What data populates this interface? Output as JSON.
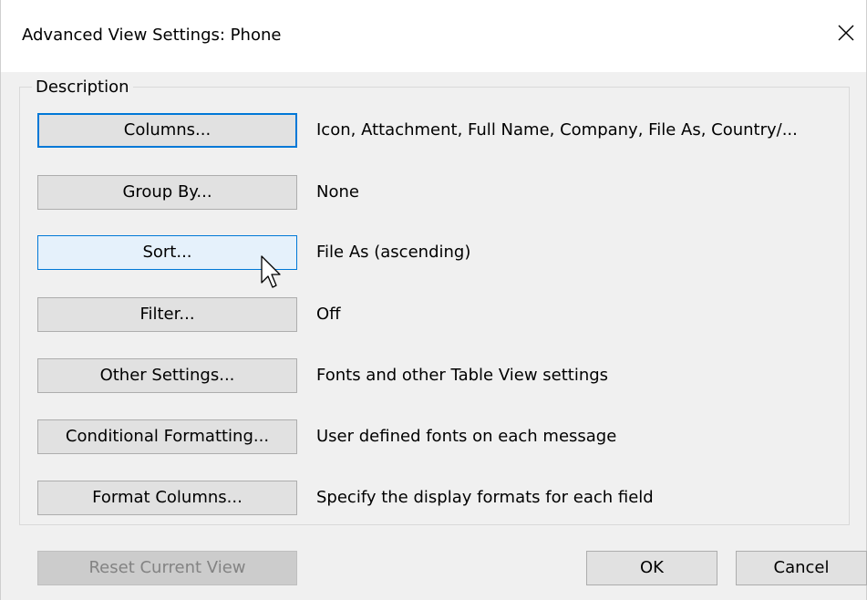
{
  "window": {
    "title": "Advanced View Settings: Phone",
    "close_icon": "close-icon"
  },
  "description_group": {
    "legend": "Description",
    "rows": [
      {
        "button_label": "Columns...",
        "value": "Icon, Attachment, Full Name, Company, File As, Country/..."
      },
      {
        "button_label": "Group By...",
        "value": "None"
      },
      {
        "button_label": "Sort...",
        "value": "File As (ascending)"
      },
      {
        "button_label": "Filter...",
        "value": "Off"
      },
      {
        "button_label": "Other Settings...",
        "value": "Fonts and other Table View settings"
      },
      {
        "button_label": "Conditional Formatting...",
        "value": "User defined fonts on each message"
      },
      {
        "button_label": "Format Columns...",
        "value": "Specify the display formats for each field"
      }
    ]
  },
  "footer": {
    "reset_label": "Reset Current View",
    "ok_label": "OK",
    "cancel_label": "Cancel"
  },
  "colors": {
    "accent": "#0078d7",
    "hover_fill": "#e5f1fb",
    "button_fill": "#e1e1e1",
    "dialog_bg": "#f0f0f0",
    "disabled_text": "#838383"
  },
  "cursor": "arrow-cursor-icon"
}
